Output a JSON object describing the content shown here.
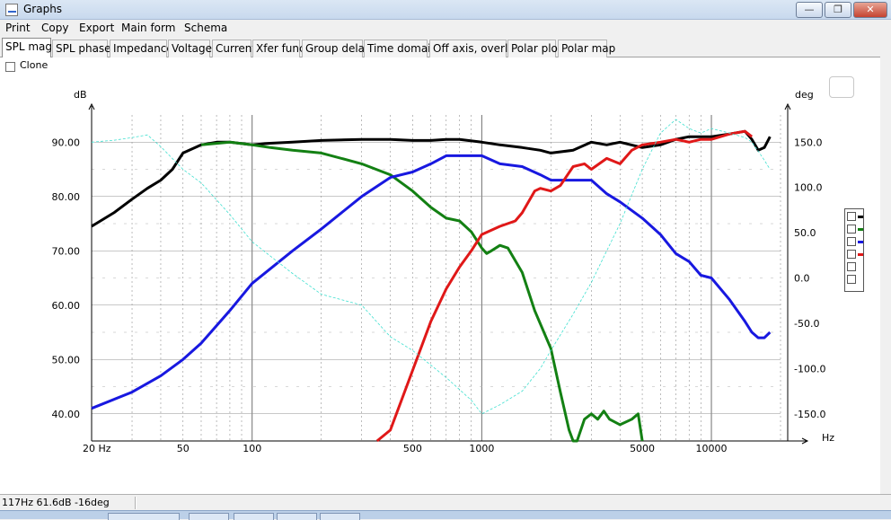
{
  "window": {
    "title": "Graphs",
    "minimize": "—",
    "maximize": "❐",
    "close": "✕"
  },
  "menu": [
    "Print",
    "Copy",
    "Export",
    "Main form",
    "Schema"
  ],
  "tabs": [
    "SPL mag",
    "SPL phase",
    "Impedance",
    "Voltage",
    "Current",
    "Xfer func",
    "Group delay",
    "Time domain",
    "Off axis, overlay",
    "Polar plot",
    "Polar map"
  ],
  "active_tab": "SPL mag",
  "clone": {
    "label": "Clone",
    "checked": false
  },
  "status": {
    "text": "117Hz 61.6dB -16deg"
  },
  "colors": {
    "black": "#000000",
    "green": "#138013",
    "blue": "#1818e0",
    "red": "#e01818",
    "phase": "#40e0d0"
  },
  "icons": [
    "app-icon",
    "minimize-icon",
    "maximize-icon",
    "close-icon",
    "copy-chart-icon"
  ],
  "chart_data": {
    "type": "line",
    "left_unit": "dB",
    "right_unit": "deg",
    "x_unit": "Hz",
    "x_scale": "log",
    "xlim": [
      20,
      20000
    ],
    "ylim": [
      35,
      95
    ],
    "y2lim": [
      -180,
      180
    ],
    "x_ticks": [
      "20 Hz",
      "50",
      "100",
      "500",
      "1000",
      "5000",
      "10000"
    ],
    "x_tick_values": [
      20,
      50,
      100,
      500,
      1000,
      5000,
      10000
    ],
    "y_ticks": [
      "90.00",
      "80.00",
      "70.00",
      "60.00",
      "50.00",
      "40.00"
    ],
    "y_tick_values": [
      90,
      80,
      70,
      60,
      50,
      40
    ],
    "y2_ticks": [
      "150.0",
      "100.0",
      "50.0",
      "0.0",
      "-50.0",
      "-100.0",
      "-150.0"
    ],
    "y2_tick_values": [
      150,
      100,
      50,
      0,
      -50,
      -100,
      -150
    ],
    "grid": true,
    "legend": "right",
    "series": [
      {
        "color": "black",
        "axis": "left",
        "x": [
          20,
          25,
          30,
          35,
          40,
          45,
          50,
          60,
          70,
          80,
          100,
          120,
          150,
          200,
          300,
          400,
          500,
          600,
          700,
          800,
          1000,
          1200,
          1500,
          1800,
          2000,
          2500,
          3000,
          3500,
          4000,
          5000,
          6000,
          7000,
          8000,
          10000,
          12000,
          14000,
          15000,
          16000,
          17000,
          18000
        ],
        "y": [
          74.5,
          77,
          79.5,
          81.5,
          83,
          85,
          88,
          89.5,
          90,
          90,
          89.5,
          89.8,
          90,
          90.3,
          90.5,
          90.5,
          90.3,
          90.3,
          90.5,
          90.5,
          90,
          89.5,
          89,
          88.5,
          88,
          88.5,
          90,
          89.5,
          90,
          89,
          89.5,
          90.5,
          91,
          91,
          91.5,
          92,
          90.5,
          88.5,
          89,
          91
        ]
      },
      {
        "color": "green",
        "axis": "left",
        "x": [
          60,
          80,
          100,
          120,
          150,
          200,
          300,
          400,
          500,
          600,
          700,
          800,
          900,
          1000,
          1050,
          1100,
          1200,
          1300,
          1500,
          1700,
          2000,
          2200,
          2400,
          2500,
          2600,
          2800,
          3000,
          3200,
          3400,
          3600,
          4000,
          4500,
          4800,
          5000
        ],
        "y": [
          89.5,
          90,
          89.5,
          89,
          88.5,
          88,
          86,
          84,
          81,
          78,
          76,
          75.5,
          73.5,
          70.5,
          69.5,
          70,
          71,
          70.5,
          66,
          59,
          52,
          44,
          37,
          34,
          35,
          39,
          40,
          39,
          40.5,
          39,
          38,
          39,
          40,
          35
        ]
      },
      {
        "color": "blue",
        "axis": "left",
        "x": [
          20,
          30,
          40,
          50,
          60,
          80,
          100,
          150,
          200,
          300,
          400,
          500,
          600,
          700,
          800,
          1000,
          1200,
          1500,
          1800,
          2000,
          2500,
          3000,
          3500,
          4000,
          5000,
          6000,
          7000,
          8000,
          9000,
          10000,
          12000,
          14000,
          15000,
          16000,
          17000,
          18000
        ],
        "y": [
          41,
          44,
          47,
          50,
          53,
          59,
          64,
          70,
          74,
          80,
          83.5,
          84.5,
          86,
          87.5,
          87.5,
          87.5,
          86,
          85.5,
          84,
          83,
          83,
          83,
          80.5,
          79,
          76,
          73,
          69.5,
          68,
          65.5,
          65,
          61,
          57,
          55,
          54,
          54,
          55
        ]
      },
      {
        "color": "red",
        "axis": "left",
        "x": [
          350,
          400,
          500,
          600,
          700,
          800,
          900,
          1000,
          1200,
          1400,
          1500,
          1700,
          1800,
          2000,
          2200,
          2500,
          2800,
          3000,
          3500,
          4000,
          4500,
          5000,
          6000,
          7000,
          8000,
          9000,
          10000,
          12000,
          14000,
          15000
        ],
        "y": [
          33,
          37,
          48,
          57,
          63,
          67,
          70,
          73,
          74.5,
          75.5,
          77,
          81,
          81.5,
          81,
          82,
          85.5,
          86,
          85,
          87,
          86,
          88.5,
          89.5,
          90,
          90.5,
          90,
          90.5,
          90.5,
          91.5,
          92,
          91
        ]
      },
      {
        "color": "phase",
        "axis": "right",
        "dashed": true,
        "x": [
          20,
          25,
          30,
          35,
          40,
          50,
          60,
          80,
          100,
          150,
          200,
          300,
          400,
          500,
          700,
          900,
          1000,
          1200,
          1500,
          1800,
          2000,
          2500,
          3000,
          3500,
          4000,
          5000,
          6000,
          7000,
          8000,
          9000,
          10000,
          12000,
          14000,
          15000,
          16000,
          17000,
          18000
        ],
        "y": [
          150,
          152,
          155,
          158,
          145,
          120,
          105,
          70,
          40,
          5,
          -18,
          -30,
          -65,
          -80,
          -110,
          -135,
          -150,
          -140,
          -125,
          -100,
          -80,
          -40,
          -5,
          30,
          60,
          120,
          160,
          175,
          165,
          160,
          165,
          160,
          155,
          150,
          140,
          130,
          120
        ]
      }
    ]
  }
}
